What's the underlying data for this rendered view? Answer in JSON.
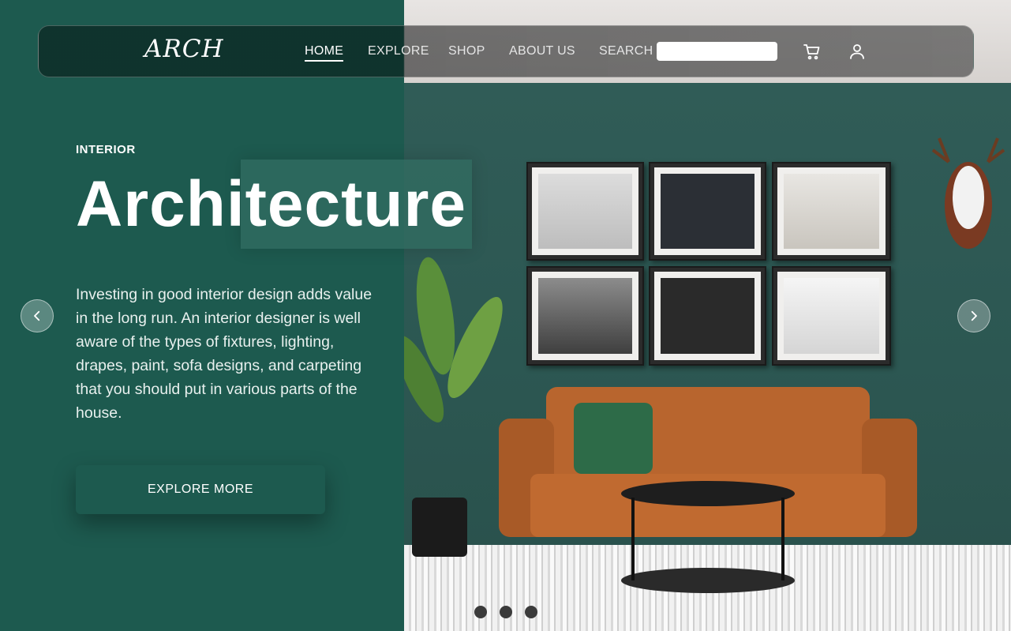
{
  "nav": {
    "logo": "ARCH",
    "links": [
      "HOME",
      "EXPLORE",
      "SHOP",
      "ABOUT US"
    ],
    "active_link": "HOME",
    "search_label": "SEARCH",
    "search_value": "",
    "cart_icon": "cart-icon",
    "user_icon": "user-icon"
  },
  "hero": {
    "eyebrow": "INTERIOR",
    "headline": "Architecture",
    "description": "Investing in good interior design adds value in the long run. An interior designer is well aware of the types of fixtures, lighting, drapes, paint, sofa designs, and carpeting that you should put in various parts of the house.",
    "cta_label": "EXPLORE MORE"
  },
  "carousel": {
    "prev_icon": "chevron-left-icon",
    "next_icon": "chevron-right-icon",
    "slide_count": 3
  },
  "colors": {
    "brand_green": "#1d5a4f",
    "navbar_dark": "#0d2d27"
  }
}
